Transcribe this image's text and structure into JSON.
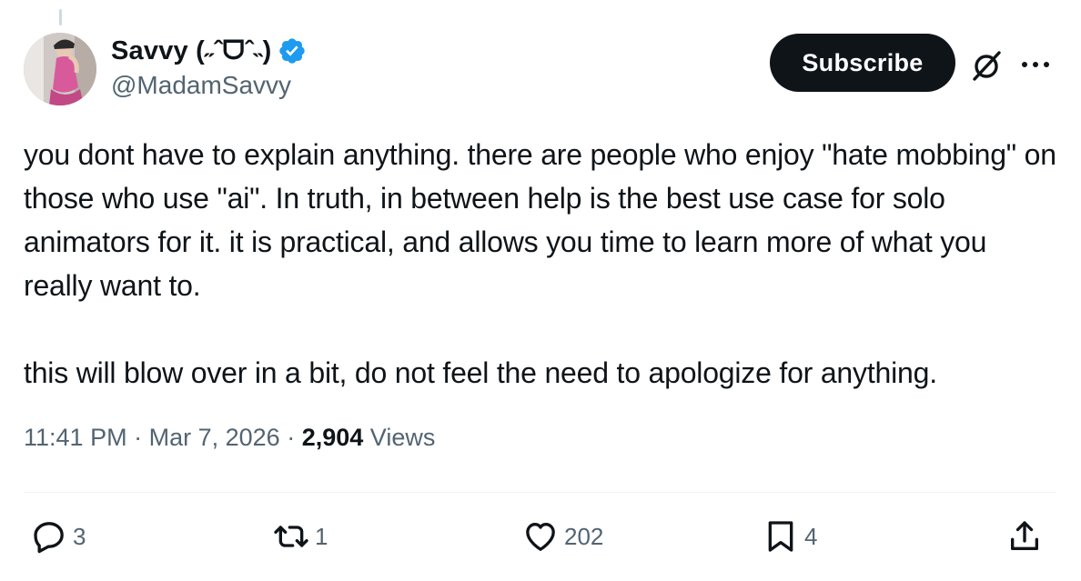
{
  "author": {
    "display_name": "Savvy (˶ˆᗜˆ˵)",
    "handle": "@MadamSavvy",
    "verified": true
  },
  "header": {
    "subscribe_label": "Subscribe"
  },
  "tweet": {
    "text": "you dont have to explain anything. there are people who enjoy \"hate mobbing\" on those who use \"ai\". In truth, in between help is the best use case for solo animators for it. it is practical, and allows you time to learn more of what you really want to.\n\nthis will blow over in a bit, do not feel the need to apologize for anything.",
    "time": "11:41 PM",
    "date": "Mar 7, 2026",
    "views_count": "2,904",
    "views_label": "Views"
  },
  "actions": {
    "replies": "3",
    "reposts": "1",
    "likes": "202",
    "bookmarks": "4"
  },
  "colors": {
    "verified": "#1d9bf0",
    "secondary_text": "#536471",
    "primary_text": "#0f1419",
    "button_bg": "#0f1419"
  },
  "icons": [
    "verified-badge-icon",
    "grok-icon",
    "more-icon",
    "reply-icon",
    "repost-icon",
    "like-icon",
    "bookmark-icon",
    "share-icon"
  ]
}
